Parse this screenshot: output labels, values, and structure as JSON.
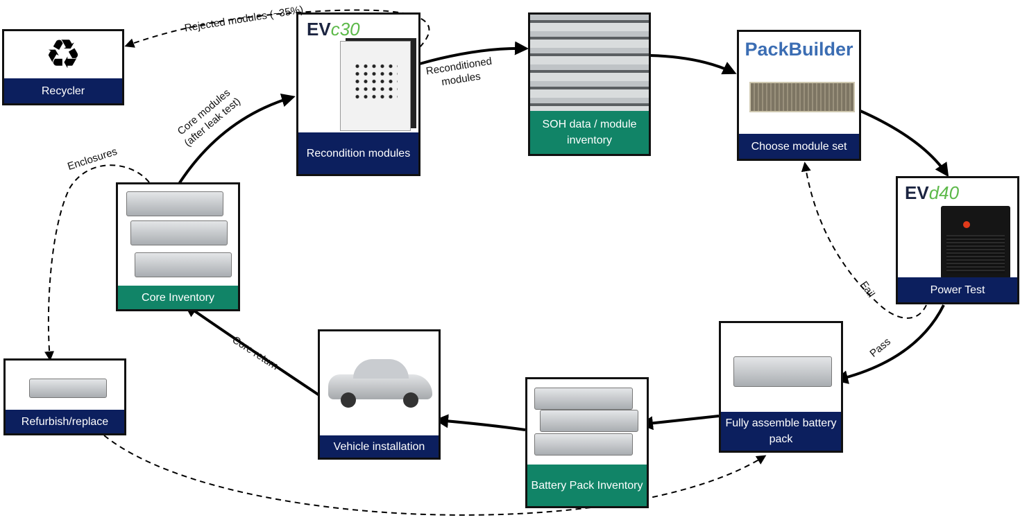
{
  "nodes": {
    "recycler": {
      "label": "Recycler",
      "icon": "recycle-icon"
    },
    "recondition": {
      "label": "Recondition modules",
      "logo_prefix": "EV",
      "logo_suffix": "c30"
    },
    "soh": {
      "label": "SOH data / module inventory"
    },
    "choose": {
      "label": "Choose module set",
      "logo": "PackBuilder"
    },
    "power_test": {
      "label": "Power Test",
      "logo_prefix": "EV",
      "logo_suffix": "d40"
    },
    "assemble": {
      "label": "Fully assemble battery pack"
    },
    "pack_inventory": {
      "label": "Battery Pack Inventory"
    },
    "vehicle": {
      "label": "Vehicle installation"
    },
    "core_inventory": {
      "label": "Core Inventory"
    },
    "refurbish": {
      "label": "Refurbish/replace"
    }
  },
  "edges": {
    "rejected": "Rejected modules (~35%)",
    "reconditioned_1": "Reconditioned",
    "reconditioned_2": "modules",
    "core_modules_1": "Core modules",
    "core_modules_2": "(after leak test)",
    "enclosures": "Enclosures",
    "fail": "Fail",
    "pass": "Pass",
    "core_return": "Core return"
  },
  "colors": {
    "navy": "#0c1f5e",
    "green": "#118467",
    "packbuilder": "#3b6db3",
    "logo_green": "#5db94a"
  }
}
